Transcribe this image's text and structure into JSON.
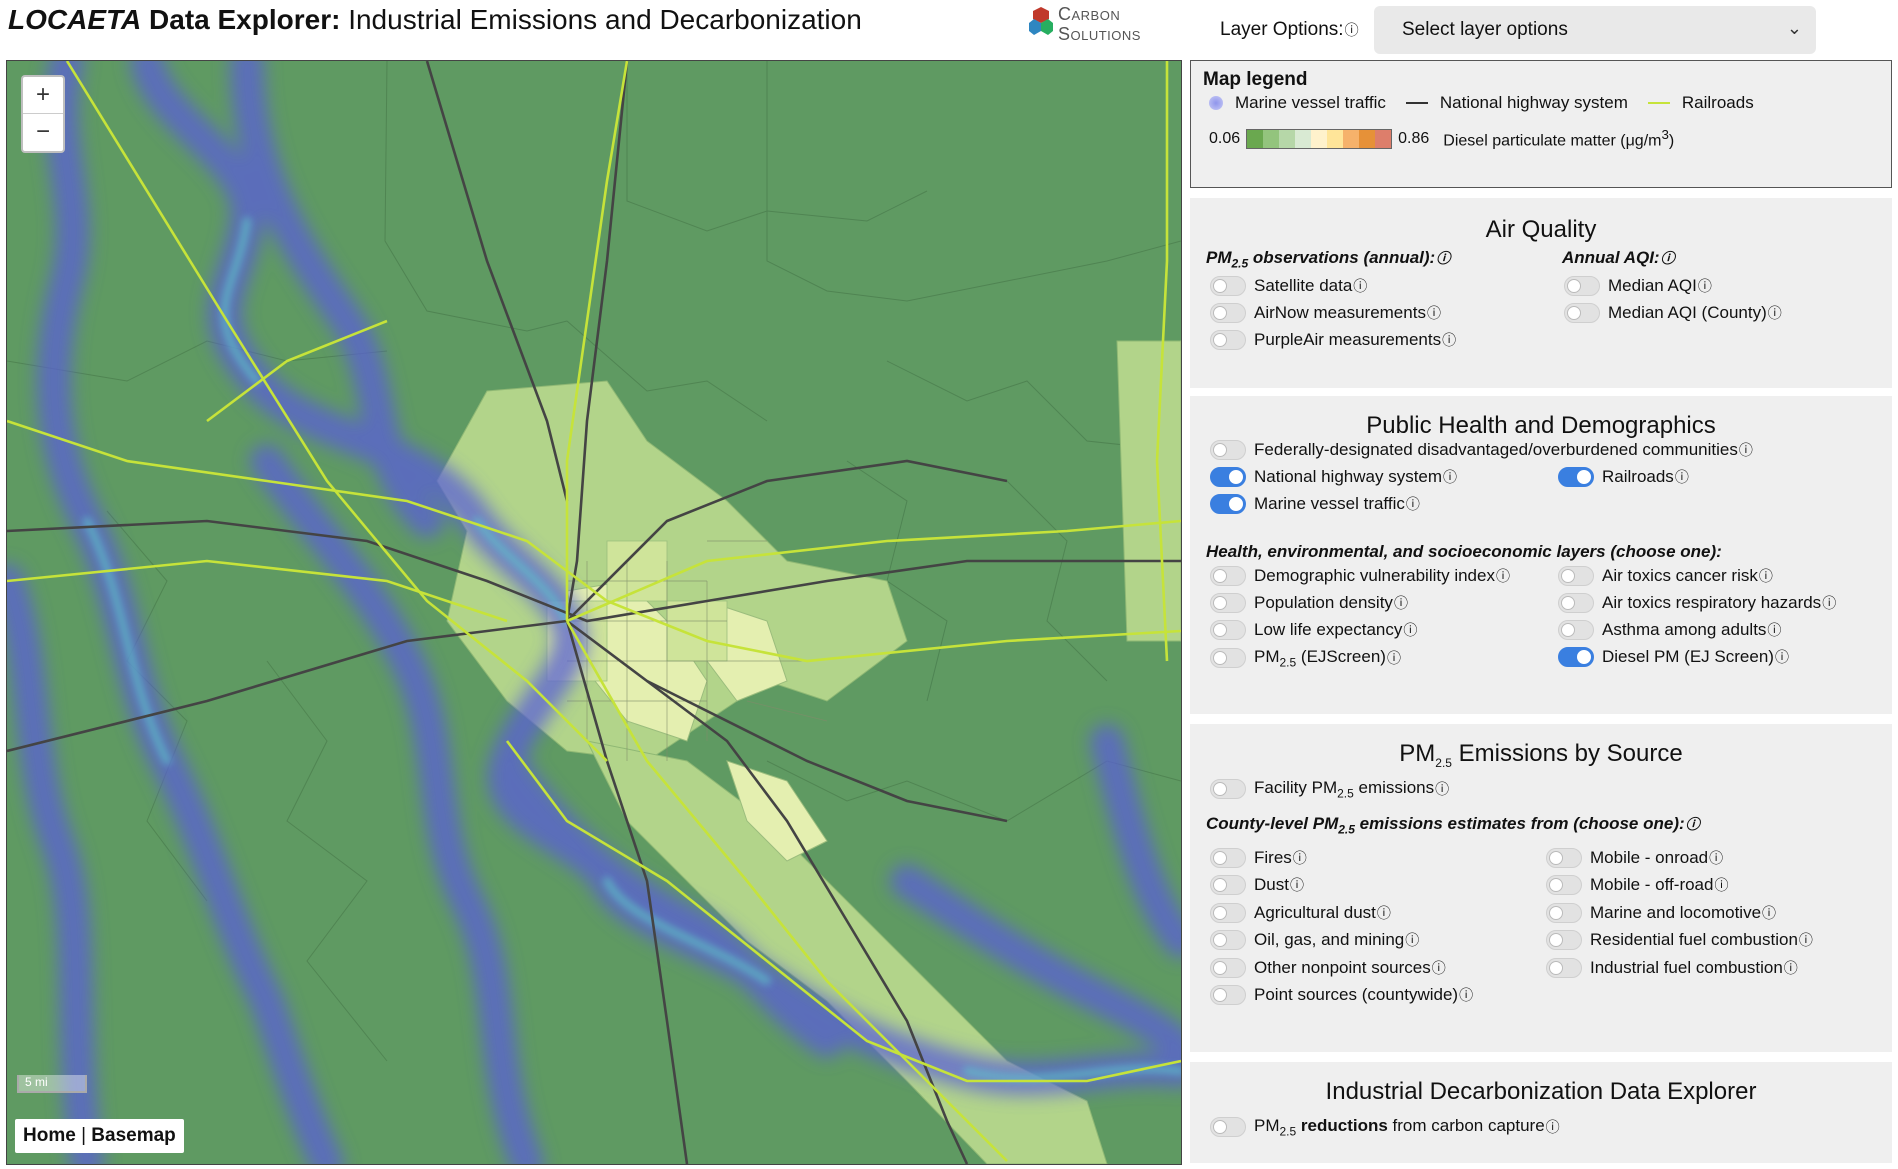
{
  "header": {
    "title_italic": "LOCAETA",
    "title_bold": " Data Explorer:",
    "title_rest": " Industrial Emissions and Decarbonization",
    "logo_line1": "Carbon",
    "logo_line2": "Solutions",
    "layer_options_label": "Layer Options:",
    "info_glyph": "ⓘ",
    "select_value": "Select layer options",
    "select_chevron": "⌄"
  },
  "map": {
    "zoom_in": "+",
    "zoom_out": "−",
    "scale_label": "5 mi",
    "home_label": "Home",
    "separator": "|",
    "basemap_label": "Basemap",
    "colors": {
      "base_green": "#5f9a62",
      "light_tract": "#b7d88e",
      "pale_tract": "#e9f1b6",
      "highway": "#444444",
      "railroad": "#c6e33a",
      "vessel": "#5a5ed8"
    }
  },
  "legend": {
    "title": "Map legend",
    "marine": "Marine vessel traffic",
    "highway": "National highway system",
    "railroads": "Railroads",
    "min": "0.06",
    "max": "0.86",
    "variable": "Diesel particulate matter (μg/m",
    "unit_sup": "3",
    "close_paren": ")",
    "ramp_colors": [
      "#6aa84f",
      "#93c47d",
      "#b6d7a8",
      "#d9ead3",
      "#fff2cc",
      "#ffe599",
      "#f6b26b",
      "#e69138",
      "#dd7e6b"
    ]
  },
  "air_quality": {
    "title": "Air Quality",
    "pm_head": "PM",
    "pm_sub": "2.5",
    "pm_tail": " observations (annual):",
    "aqi_head": "Annual AQI:",
    "toggles": [
      {
        "label": "Satellite data",
        "on": false
      },
      {
        "label": "AirNow measurements",
        "on": false
      },
      {
        "label": "PurpleAir measurements",
        "on": false
      },
      {
        "label": "Median AQI",
        "on": false
      },
      {
        "label": "Median AQI (County)",
        "on": false
      }
    ]
  },
  "public_health": {
    "title": "Public Health and Demographics",
    "subhead": "Health, environmental, and socioeconomic layers (choose one):",
    "toggles": [
      {
        "label": "Federally-designated disadvantaged/overburdened communities",
        "on": false
      },
      {
        "label": "National highway system",
        "on": true
      },
      {
        "label": "Railroads",
        "on": true
      },
      {
        "label": "Marine vessel traffic",
        "on": true
      },
      {
        "label": "Demographic vulnerability index",
        "on": false
      },
      {
        "label": "Population density",
        "on": false
      },
      {
        "label": "Low life expectancy",
        "on": false
      },
      {
        "label": "PM",
        "sub": "2.5",
        "tail": " (EJScreen)",
        "on": false
      },
      {
        "label": "Air toxics cancer risk",
        "on": false
      },
      {
        "label": "Air toxics respiratory hazards",
        "on": false
      },
      {
        "label": "Asthma among adults",
        "on": false
      },
      {
        "label": "Diesel PM (EJ Screen)",
        "on": true
      }
    ]
  },
  "emissions": {
    "title_head": "PM",
    "title_sub": "2.5",
    "title_tail": " Emissions by Source",
    "facility_head": "Facility PM",
    "facility_sub": "2.5",
    "facility_tail": " emissions",
    "county_head": "County-level PM",
    "county_sub": "2.5",
    "county_tail": " emissions estimates from (choose one):",
    "left": [
      "Fires",
      "Dust",
      "Agricultural dust",
      "Oil, gas, and mining",
      "Other nonpoint sources",
      "Point sources (countywide)"
    ],
    "right": [
      "Mobile - onroad",
      "Mobile - off-road",
      "Marine and locomotive",
      "Residential fuel combustion",
      "Industrial fuel combustion"
    ]
  },
  "decarbonization": {
    "title": "Industrial Decarbonization Data Explorer",
    "item_head": "PM",
    "item_sub": "2.5",
    "item_bold": " reductions",
    "item_tail": " from carbon capture"
  }
}
